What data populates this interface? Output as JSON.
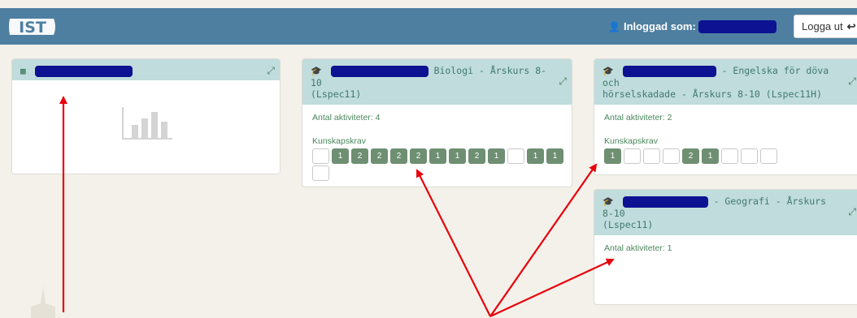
{
  "header": {
    "logo_text": "IST",
    "logged_in_label": "Inloggad som:",
    "logout_label": "Logga ut"
  },
  "cards": {
    "biologi": {
      "title": "Biologi - Årskurs 8-10",
      "title_line2": "(Lspec11)",
      "activities": "Antal aktiviteter: 4",
      "kunskapskrav_label": "Kunskapskrav",
      "chips": [
        "",
        "1",
        "2",
        "2",
        "2",
        "2",
        "1",
        "1",
        "2",
        "1",
        "",
        "1",
        "1",
        ""
      ]
    },
    "engelska": {
      "title": "- Engelska för döva och",
      "title_line2": "hörselskadade - Årskurs 8-10 (Lspec11H)",
      "activities": "Antal aktiviteter: 2",
      "kunskapskrav_label": "Kunskapskrav",
      "chips": [
        "1",
        "",
        "",
        "",
        "2",
        "1",
        "",
        "",
        ""
      ]
    },
    "geografi": {
      "title": "- Geografi - Årskurs 8-10",
      "title_line2": "(Lspec11)",
      "activities": "Antal aktiviteter: 1"
    }
  },
  "icons": {
    "user": "user-icon",
    "logout": "sign-out-icon",
    "card": "graduation-cap-icon",
    "expand": "expand-icon",
    "chart": "bar-chart-icon"
  },
  "colors": {
    "topbar": "#4e7fa0",
    "card_header": "#c0dcdc",
    "chip_filled": "#6f8f72",
    "redaction": "#0c1292",
    "annotation": "#e8000b"
  }
}
